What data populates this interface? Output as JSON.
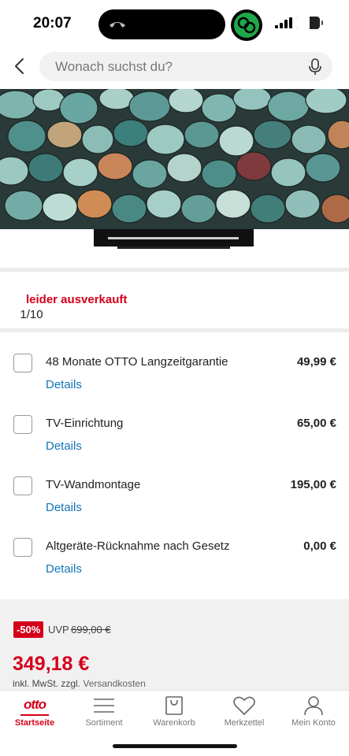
{
  "status_bar": {
    "time": "20:07",
    "battery": "54"
  },
  "search": {
    "placeholder": "Wonach suchst du?"
  },
  "gallery": {
    "counter": "1/10"
  },
  "availability": {
    "text": "leider ausverkauft"
  },
  "options": [
    {
      "label": "48 Monate OTTO Langzeitgarantie",
      "price": "49,99 €",
      "details": "Details"
    },
    {
      "label": "TV-Einrichtung",
      "price": "65,00 €",
      "details": "Details"
    },
    {
      "label": "TV-Wandmontage",
      "price": "195,00 €",
      "details": "Details"
    },
    {
      "label": "Altgeräte-Rücknahme nach Gesetz",
      "price": "0,00 €",
      "details": "Details"
    }
  ],
  "pricing": {
    "discount": "-50%",
    "uvp_label": "UVP",
    "uvp_value": "699,00 €",
    "price": "349,18 €",
    "tax_note": "inkl. MwSt. zzgl.",
    "shipping_link": "Versandkosten"
  },
  "bottom_nav": {
    "logo": "otto",
    "items": [
      {
        "label": "Startseite",
        "icon": "otto-logo",
        "active": true
      },
      {
        "label": "Sortiment",
        "icon": "menu-icon",
        "active": false
      },
      {
        "label": "Warenkorb",
        "icon": "bag-icon",
        "active": false
      },
      {
        "label": "Merkzettel",
        "icon": "heart-icon",
        "active": false
      },
      {
        "label": "Mein Konto",
        "icon": "user-icon",
        "active": false
      }
    ]
  },
  "colors": {
    "brand_red": "#d4001a",
    "link_blue": "#1474b9",
    "panel_gray": "#f1f1f1"
  }
}
